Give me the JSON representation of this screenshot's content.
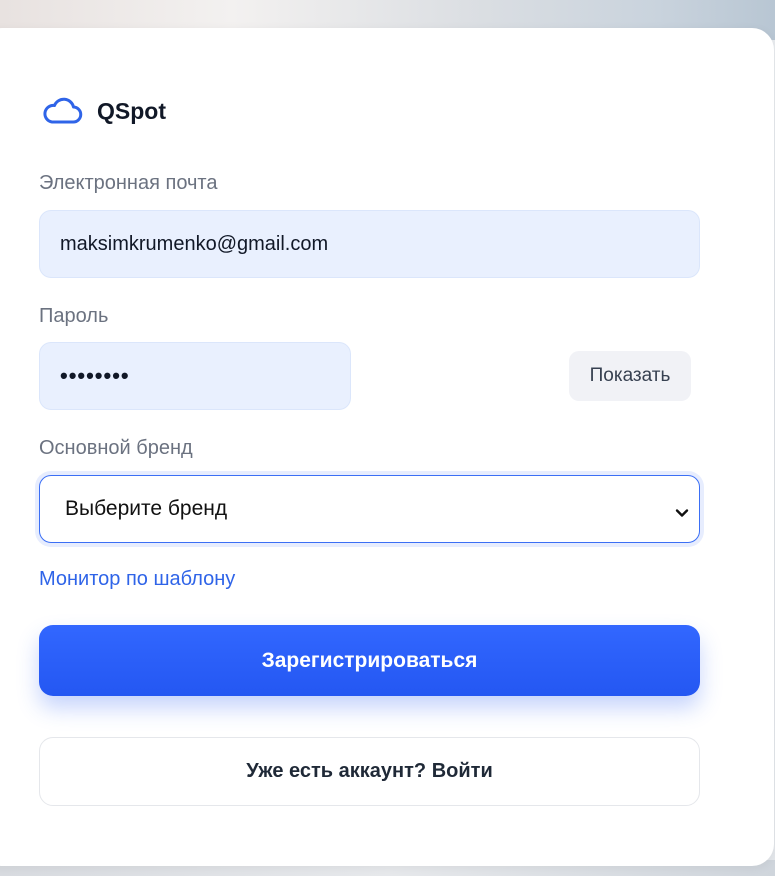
{
  "brand": {
    "name": "QSpot",
    "logo_icon": "cloud-icon",
    "accent_color": "#2f64e8"
  },
  "form": {
    "email": {
      "label": "Электронная почта",
      "value": "maksimkrumenko@gmail.com"
    },
    "password": {
      "label": "Пароль",
      "value": "••••••••",
      "show_label": "Показать"
    },
    "brand_select": {
      "label": "Основной бренд",
      "value": "Выберите бренд",
      "icon": "chevron-down-icon"
    },
    "template_link": "Монитор по шаблону",
    "submit_label": "Зарегистрироваться",
    "login_label": "Уже есть аккаунт? Войти"
  }
}
